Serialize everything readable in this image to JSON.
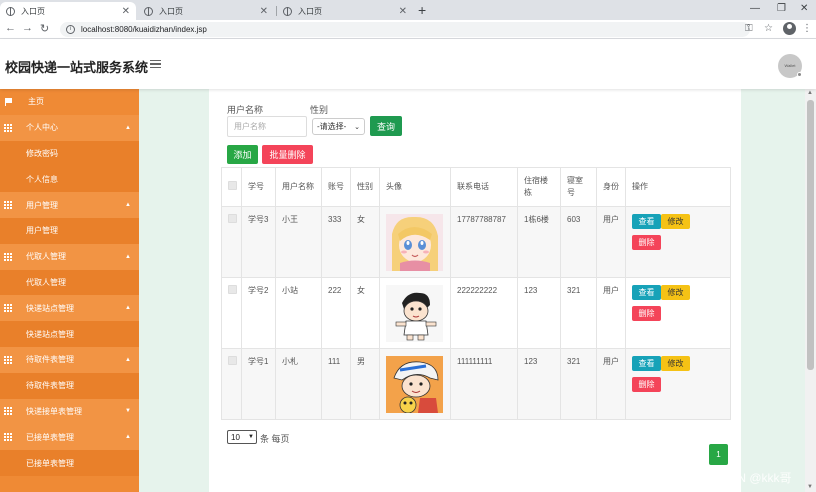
{
  "browser": {
    "tabs": [
      {
        "title": "入口页",
        "active": true
      },
      {
        "title": "入口页",
        "active": false
      },
      {
        "title": "入口页",
        "active": false
      }
    ],
    "url": "localhost:8080/kuaidizhan/index.jsp"
  },
  "header": {
    "title": "校园快递一站式服务系统",
    "avatar_text": "Wallet"
  },
  "sidebar": {
    "items": [
      {
        "label": "主页",
        "type": "home"
      },
      {
        "label": "个人中心",
        "type": "group"
      },
      {
        "label": "修改密码",
        "type": "sub"
      },
      {
        "label": "个人信息",
        "type": "sub"
      },
      {
        "label": "用户管理",
        "type": "group"
      },
      {
        "label": "用户管理",
        "type": "sub"
      },
      {
        "label": "代取人管理",
        "type": "group"
      },
      {
        "label": "代取人管理",
        "type": "sub"
      },
      {
        "label": "快递站点管理",
        "type": "group"
      },
      {
        "label": "快递站点管理",
        "type": "sub"
      },
      {
        "label": "待取件表管理",
        "type": "group"
      },
      {
        "label": "待取件表管理",
        "type": "sub"
      },
      {
        "label": "快递接单表管理",
        "type": "group"
      },
      {
        "label": "已接单表管理",
        "type": "group"
      },
      {
        "label": "已接单表管理",
        "type": "sub"
      }
    ]
  },
  "search": {
    "username_label": "用户名称",
    "username_placeholder": "用户名称",
    "gender_label": "性别",
    "gender_selected": "-请选择-",
    "search_button": "查询"
  },
  "actions": {
    "add": "添加",
    "batch_delete": "批量删除"
  },
  "table": {
    "headers": [
      "",
      "学号",
      "用户名称",
      "账号",
      "性别",
      "头像",
      "联系电话",
      "住宿楼栋",
      "寝室号",
      "身份",
      "操作"
    ],
    "rows": [
      {
        "student_id": "学号3",
        "name": "小王",
        "account": "333",
        "gender": "女",
        "phone": "17787788787",
        "building": "1栋6楼",
        "room": "603",
        "role": "用户"
      },
      {
        "student_id": "学号2",
        "name": "小站",
        "account": "222",
        "gender": "女",
        "phone": "222222222",
        "building": "123",
        "room": "321",
        "role": "用户"
      },
      {
        "student_id": "学号1",
        "name": "小札",
        "account": "111",
        "gender": "男",
        "phone": "111111111",
        "building": "123",
        "room": "321",
        "role": "用户"
      }
    ],
    "view_label": "查看",
    "edit_label": "修改",
    "delete_label": "删除"
  },
  "pagination": {
    "page_size": "10",
    "per_page_text": "条 每页",
    "current_page": "1"
  },
  "watermark": "CSDN @kkk哥",
  "colors": {
    "sidebar": "#ef8a35",
    "primary_green": "#28a745",
    "danger": "#f44459",
    "info": "#17a2b8",
    "warning": "#f5c215"
  }
}
